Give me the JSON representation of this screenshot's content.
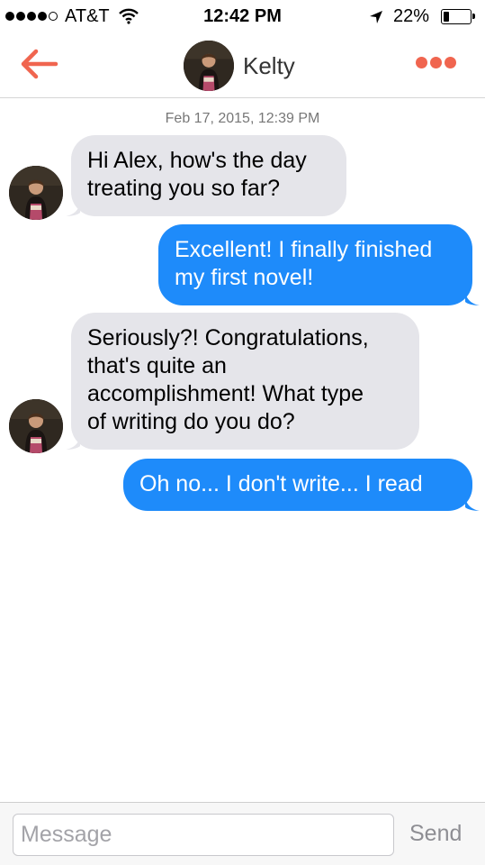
{
  "status_bar": {
    "carrier": "AT&T",
    "time": "12:42 PM",
    "battery_percent": "22%",
    "battery_level": 0.22,
    "signal_bars_filled": 4,
    "signal_bars_total": 5,
    "icons": [
      "wifi-icon",
      "location-icon",
      "battery-icon"
    ]
  },
  "nav": {
    "back_icon": "arrow-left-icon",
    "contact_name": "Kelty",
    "more_icon": "ellipsis-icon",
    "accent_color": "#f0654f"
  },
  "conversation": {
    "timestamp": "Feb 17, 2015, 12:39 PM",
    "messages": [
      {
        "direction": "incoming",
        "lines": [
          "Hi Alex, how's the day",
          "treating you so far?"
        ]
      },
      {
        "direction": "outgoing",
        "lines": [
          "Excellent! I finally finished",
          "my first novel!"
        ]
      },
      {
        "direction": "incoming",
        "lines": [
          "Seriously?!  Congratulations,",
          "that's quite an",
          "accomplishment! What type",
          "of writing do you do?"
        ]
      },
      {
        "direction": "outgoing",
        "lines": [
          "Oh no... I don't write... I read"
        ]
      }
    ],
    "incoming_bubble_color": "#e5e5ea",
    "outgoing_bubble_color": "#1e8bfa"
  },
  "input": {
    "placeholder": "Message",
    "value": "",
    "send_label": "Send"
  }
}
